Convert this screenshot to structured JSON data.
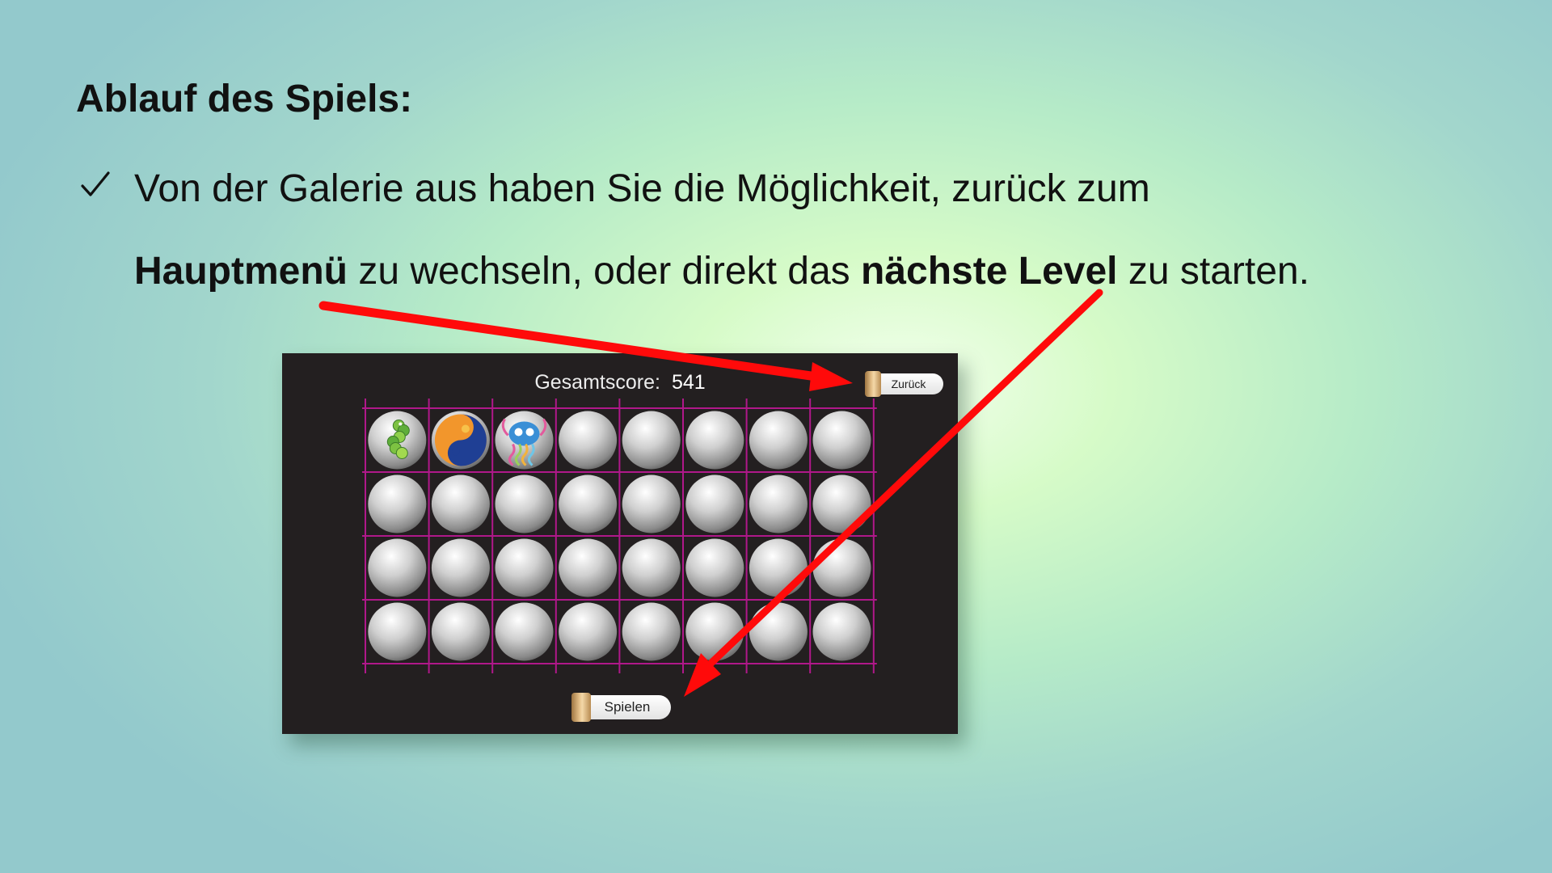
{
  "slide": {
    "title": "Ablauf des Spiels:",
    "bullet_line1": "Von der Galerie aus haben Sie die Möglichkeit, zurück zum",
    "bullet_bold1": "Hauptmenü",
    "bullet_mid": " zu wechseln, oder direkt das ",
    "bullet_bold2": "nächste Level",
    "bullet_end": " zu starten."
  },
  "game": {
    "score_label": "Gesamtscore:",
    "score_value": "541",
    "back_button": "Zurück",
    "play_button": "Spielen",
    "gallery": {
      "rows": 4,
      "cols": 8,
      "unlocked": [
        "caterpillar-creature",
        "yin-yang-creature",
        "jellyfish-creature"
      ]
    }
  },
  "colors": {
    "arrow": "#ff0a0a",
    "grid_line": "#b0188a",
    "panel": "#231f20"
  }
}
